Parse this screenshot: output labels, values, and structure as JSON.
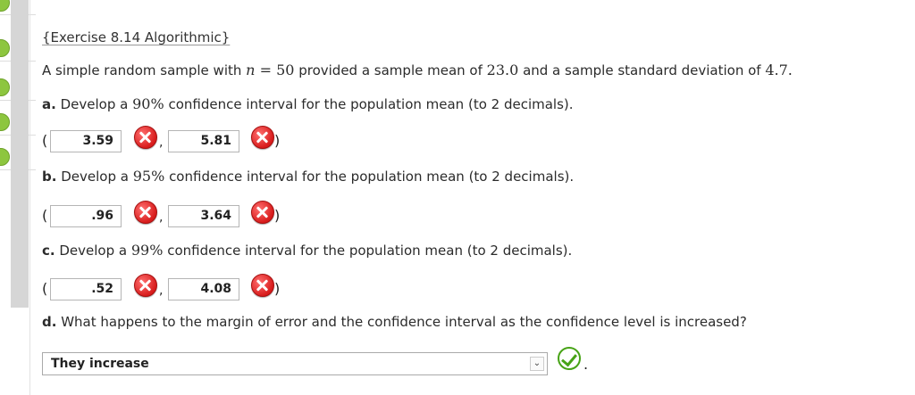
{
  "title": "{Exercise 8.14 Algorithmic}",
  "intro": {
    "prefix": "A simple random sample with",
    "n_label": "n",
    "equals_value": "= 50",
    "middle": "provided a sample mean of",
    "mean": "23.0",
    "between": "and a sample standard deviation of",
    "sd": "4.7",
    "suffix": "."
  },
  "parts": [
    {
      "letter": "a.",
      "prefix": "Develop a",
      "percent": "90%",
      "suffix": "confidence interval for the population mean (to 2 decimals).",
      "lower": "3.59",
      "upper": "5.81",
      "lower_status": "incorrect",
      "upper_status": "incorrect"
    },
    {
      "letter": "b.",
      "prefix": "Develop a",
      "percent": "95%",
      "suffix": "confidence interval for the population mean (to 2 decimals).",
      "lower": ".96",
      "upper": "3.64",
      "lower_status": "incorrect",
      "upper_status": "incorrect"
    },
    {
      "letter": "c.",
      "prefix": "Develop a",
      "percent": "99%",
      "suffix": "confidence interval for the population mean (to 2 decimals).",
      "lower": ".52",
      "upper": "4.08",
      "lower_status": "incorrect",
      "upper_status": "incorrect"
    }
  ],
  "part_d": {
    "letter": "d.",
    "question": "What happens to the margin of error and the confidence interval as the confidence level is increased?",
    "selected": "They increase",
    "status": "correct"
  },
  "symbols": {
    "open_paren": "(",
    "close_paren": ")",
    "comma": ",",
    "period": ".",
    "dropdown_arrow": "⌄"
  },
  "colors": {
    "incorrect": "#d81c1c",
    "correct": "#47a316",
    "rail_status": "#8dc63f"
  },
  "icons": {
    "incorrect": "x-circle-icon",
    "correct": "check-circle-icon",
    "dropdown": "chevron-down-icon"
  }
}
